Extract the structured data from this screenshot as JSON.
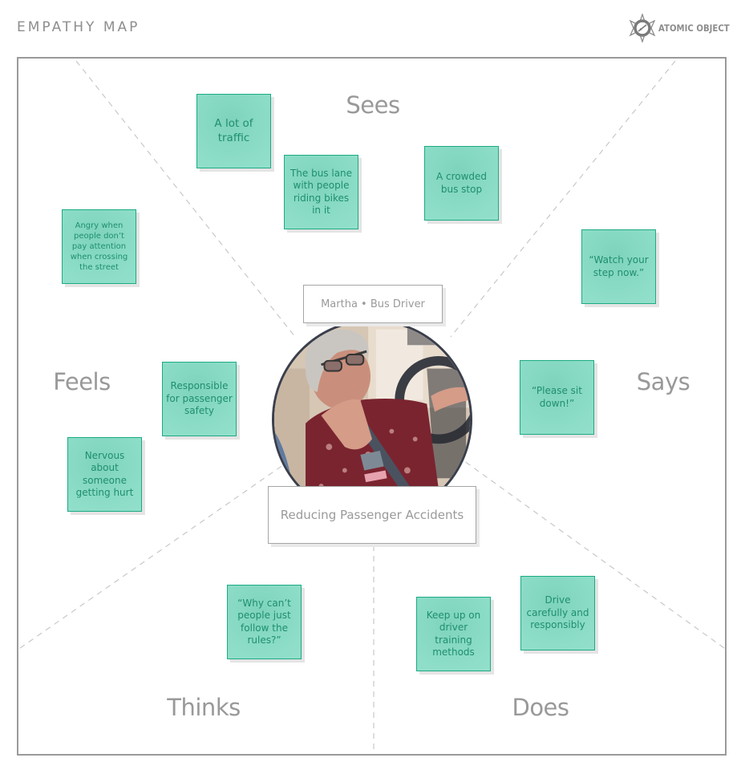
{
  "header": {
    "title": "EMPATHY MAP",
    "logo_text": "ATOMIC OBJECT",
    "logo_icon": "atom-icon"
  },
  "persona": {
    "name_label": "Martha • Bus Driver",
    "goal": "Reducing Passenger Accidents",
    "photo": "persona-photo"
  },
  "quadrants": {
    "sees": {
      "label": "Sees",
      "notes": [
        "A lot of traffic",
        "The bus lane with people riding bikes in it",
        "A crowded bus stop"
      ]
    },
    "says": {
      "label": "Says",
      "notes": [
        "“Watch your step now.”",
        "“Please sit down!”"
      ]
    },
    "feels": {
      "label": "Feels",
      "notes": [
        "Angry when people don’t pay attention when crossing the street",
        "Responsible for passenger safety",
        "Nervous about someone getting hurt"
      ]
    },
    "thinks": {
      "label": "Thinks",
      "notes": [
        "“Why can’t people just follow the rules?”"
      ]
    },
    "does": {
      "label": "Does",
      "notes": [
        "Keep up on driver training methods",
        "Drive carefully and responsibly"
      ]
    }
  },
  "colors": {
    "sticky_fill": "#8bdcc6",
    "sticky_border": "#1bab84",
    "sticky_text": "#1e8f6e",
    "label_text": "#999999",
    "frame": "#9a9a9a"
  }
}
